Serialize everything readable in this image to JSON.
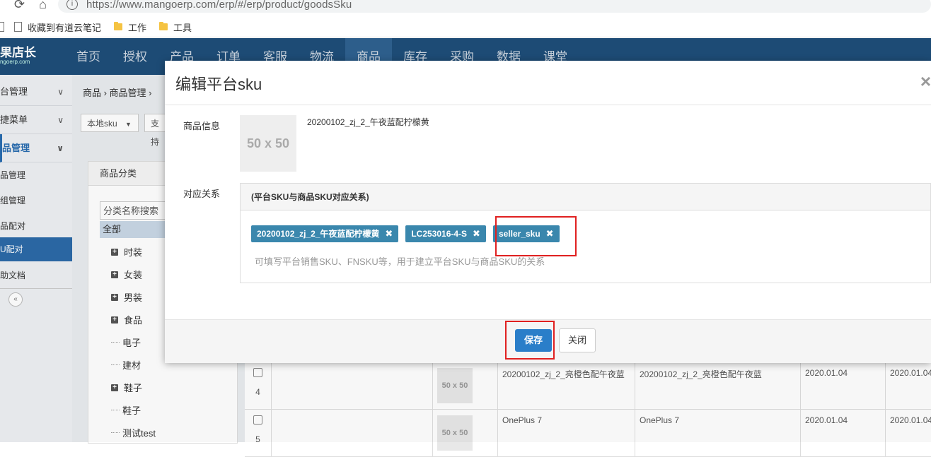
{
  "browser": {
    "url": "https://www.mangoerp.com/erp/#/erp/product/goodsSku",
    "bookmarks": [
      {
        "label": "收藏到有道云笔记",
        "icon": "page-icon"
      },
      {
        "label": "工作",
        "icon": "folder-icon"
      },
      {
        "label": "工具",
        "icon": "folder-icon"
      }
    ]
  },
  "app": {
    "logo_main": "果店长",
    "logo_sub": "ngoerp.com",
    "nav": [
      "首页",
      "授权",
      "产品",
      "订单",
      "客服",
      "物流",
      "商品",
      "库存",
      "采购",
      "数据",
      "课堂"
    ],
    "active_nav": "商品"
  },
  "sidebar": {
    "groups": [
      {
        "label": "台管理"
      },
      {
        "label": "捷菜单"
      },
      {
        "label": "品管理"
      }
    ],
    "items": [
      "品管理",
      "组管理",
      "品配对",
      "U配对",
      "助文档"
    ],
    "collapse": "«"
  },
  "main": {
    "breadcrumb": "商品 › 商品管理 ›",
    "toolbar": {
      "local_sku": "本地sku",
      "support": "支持"
    },
    "category_panel": {
      "title": "商品分类",
      "search_placeholder": "分类名称搜索",
      "all": "全部",
      "items": [
        {
          "label": "时装",
          "expand": true
        },
        {
          "label": "女装",
          "expand": true
        },
        {
          "label": "男装",
          "expand": true
        },
        {
          "label": "食品",
          "expand": true
        },
        {
          "label": "电子",
          "expand": false
        },
        {
          "label": "建材",
          "expand": false
        },
        {
          "label": "鞋子",
          "expand": true
        },
        {
          "label": "鞋子",
          "expand": false
        },
        {
          "label": "测试test",
          "expand": false
        }
      ]
    },
    "table_rows": [
      {
        "index": "4",
        "thumb": "50 x 50",
        "platform_sku": "20200102_zj_2_亮橙色配午夜蓝",
        "goods_sku": "20200102_zj_2_亮橙色配午夜蓝",
        "date1": "2020.01.04",
        "date2": "2020.01.04"
      },
      {
        "index": "5",
        "thumb": "50 x 50",
        "platform_sku": "OnePlus 7",
        "goods_sku": "OnePlus 7",
        "date1": "2020.01.04",
        "date2": "2020.01.04"
      }
    ]
  },
  "modal": {
    "title": "编辑平台sku",
    "close": "×",
    "product_info_label": "商品信息",
    "product_thumb": "50 x 50",
    "product_name": "20200102_zj_2_午夜蓝配柠檬黄",
    "relation_label": "对应关系",
    "relation_head": "(平台SKU与商品SKU对应关系)",
    "tags": [
      "20200102_zj_2_午夜蓝配柠檬黄",
      "LC253016-4-S",
      "seller_sku"
    ],
    "tag_remove": "✖",
    "tag_placeholder": "可填写平台销售SKU、FNSKU等，用于建立平台SKU与商品SKU的关系",
    "save": "保存",
    "close_button": "关闭"
  }
}
